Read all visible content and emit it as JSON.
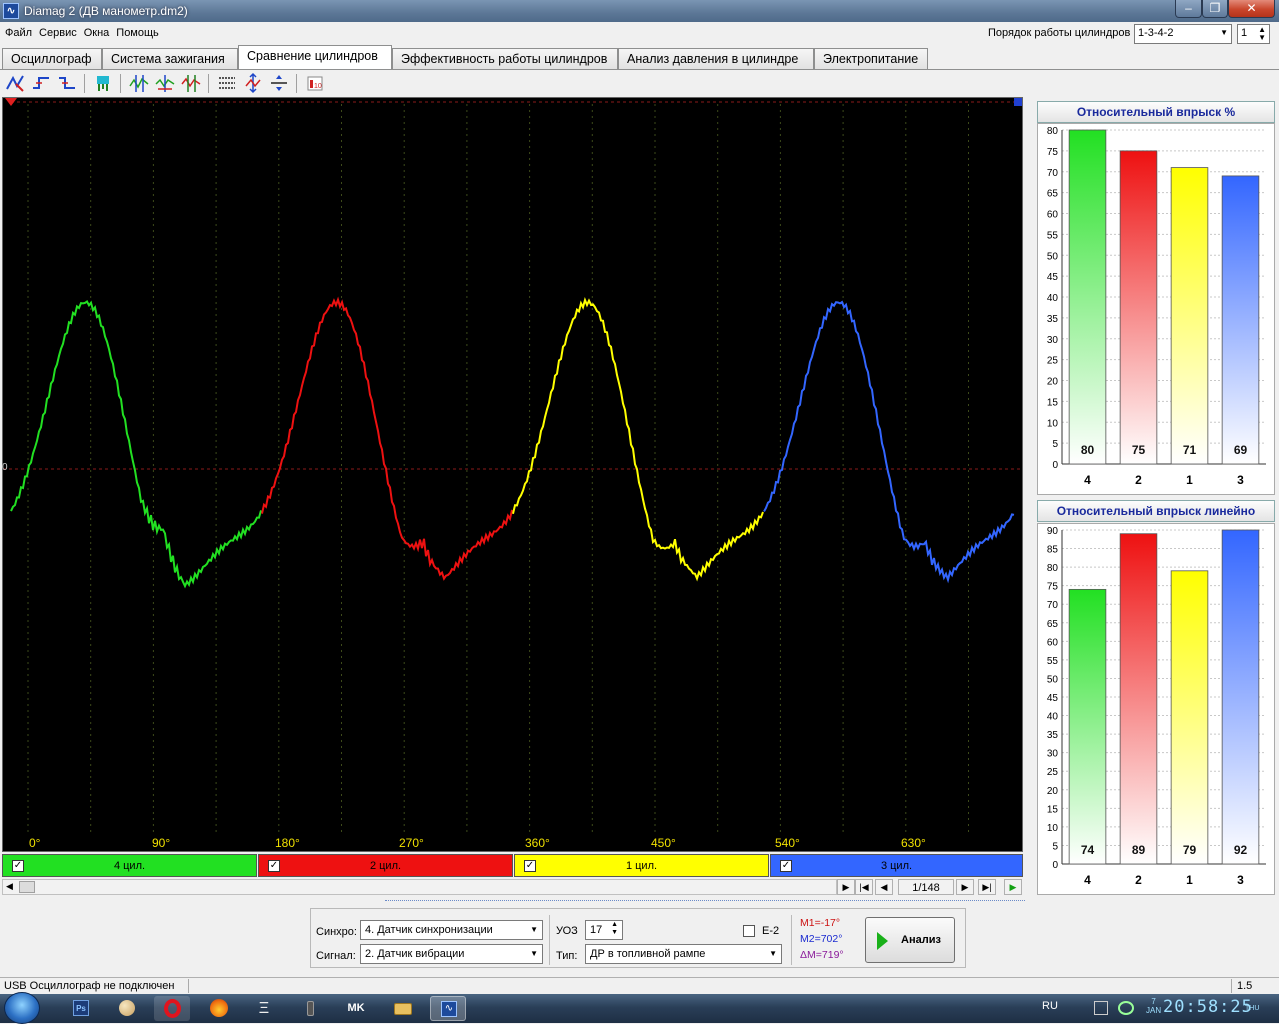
{
  "window": {
    "title": "Diamag 2 (ДВ манометр.dm2)",
    "app_icon": "waveform-icon"
  },
  "menu": [
    "Файл",
    "Сервис",
    "Окна",
    "Помощь"
  ],
  "cylinder_order": {
    "label": "Порядок работы цилиндров",
    "value": "1-3-4-2",
    "start": "1"
  },
  "tabs": [
    {
      "label": "Осциллограф",
      "active": false
    },
    {
      "label": "Система зажигания",
      "active": false
    },
    {
      "label": "Сравнение цилиндров",
      "active": true
    },
    {
      "label": "Эффективность работы цилиндров",
      "active": false
    },
    {
      "label": "Анализ давления в цилиндре",
      "active": false
    },
    {
      "label": "Электропитание",
      "active": false
    }
  ],
  "scope": {
    "zero_label": "0",
    "degree_labels": [
      "0°",
      "90°",
      "180°",
      "270°",
      "360°",
      "450°",
      "540°",
      "630°"
    ]
  },
  "channels": [
    {
      "label": "4 цил.",
      "color": "#22e022",
      "checked": true
    },
    {
      "label": "2 цил.",
      "color": "#ee1111",
      "checked": true
    },
    {
      "label": "1 цил.",
      "color": "#ffff00",
      "checked": true
    },
    {
      "label": "3 цил.",
      "color": "#3366ff",
      "checked": true
    }
  ],
  "navigation": {
    "page": "1/148"
  },
  "chart_data": [
    {
      "type": "bar",
      "title": "Относительный впрыск %",
      "categories": [
        "4",
        "2",
        "1",
        "3"
      ],
      "values": [
        80,
        75,
        71,
        69
      ],
      "colors": [
        "#22e022",
        "#ee1111",
        "#ffff00",
        "#3366ff"
      ],
      "ylim": [
        0,
        80
      ],
      "yticks": [
        0,
        5,
        10,
        15,
        20,
        25,
        30,
        35,
        40,
        45,
        50,
        55,
        60,
        65,
        70,
        75,
        80
      ],
      "grid": true
    },
    {
      "type": "bar",
      "title": "Относительный впрыск линейно",
      "categories": [
        "4",
        "2",
        "1",
        "3"
      ],
      "values": [
        74,
        89,
        79,
        92
      ],
      "colors": [
        "#22e022",
        "#ee1111",
        "#ffff00",
        "#3366ff"
      ],
      "ylim": [
        0,
        90
      ],
      "yticks": [
        0,
        5,
        10,
        15,
        20,
        25,
        30,
        35,
        40,
        45,
        50,
        55,
        60,
        65,
        70,
        75,
        80,
        85,
        90
      ],
      "grid": true
    }
  ],
  "controls": {
    "sync_label": "Синхро:",
    "sync_value": "4.  Датчик синхронизации",
    "signal_label": "Сигнал:",
    "signal_value": "2.  Датчик вибрации",
    "uoz_label": "УОЗ",
    "uoz_value": "17",
    "e2_label": "E-2",
    "type_label": "Тип:",
    "type_value": "ДР в топливной рампе",
    "m1": "M1=-17°",
    "m2": "M2=702°",
    "dm": "ΔM=719°",
    "m1_color": "#cc1111",
    "m2_color": "#1a2ad0",
    "dm_color": "#8a1a9a",
    "analyze_label": "Анализ"
  },
  "status": {
    "text": "USB Осциллограф не подключен",
    "version": "1.5"
  },
  "taskbar": {
    "lang": "RU",
    "clock": "20:58:25",
    "date_month": "JAN",
    "date_day": "7",
    "weekday": "THU",
    "apps": [
      "photoshop-icon",
      "paint-icon",
      "opera-icon",
      "firefox-icon",
      "xi-app-icon",
      "phone-icon",
      "mk-app-icon",
      "folder-icon",
      "diamag-icon"
    ]
  }
}
